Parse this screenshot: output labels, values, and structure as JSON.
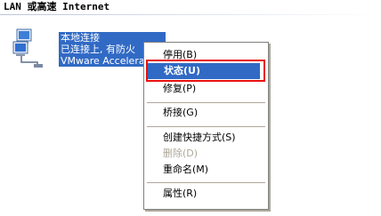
{
  "header": {
    "title": "LAN 或高速 Internet"
  },
  "connection": {
    "name": "本地连接",
    "status": "已连接上, 有防火",
    "device": "VMware Accelerat"
  },
  "context_menu": {
    "items": [
      {
        "label": "停用(B)"
      },
      {
        "label": "状态(U)",
        "bold": true,
        "highlighted": true
      },
      {
        "label": "修复(P)"
      },
      {
        "label": "桥接(G)"
      },
      {
        "label": "创建快捷方式(S)"
      },
      {
        "label": "删除(D)",
        "disabled": true
      },
      {
        "label": "重命名(M)"
      },
      {
        "label": "属性(R)"
      }
    ]
  },
  "colors": {
    "selection": "#316ac5",
    "highlight_box": "#e81010",
    "disabled_text": "#aca899"
  }
}
